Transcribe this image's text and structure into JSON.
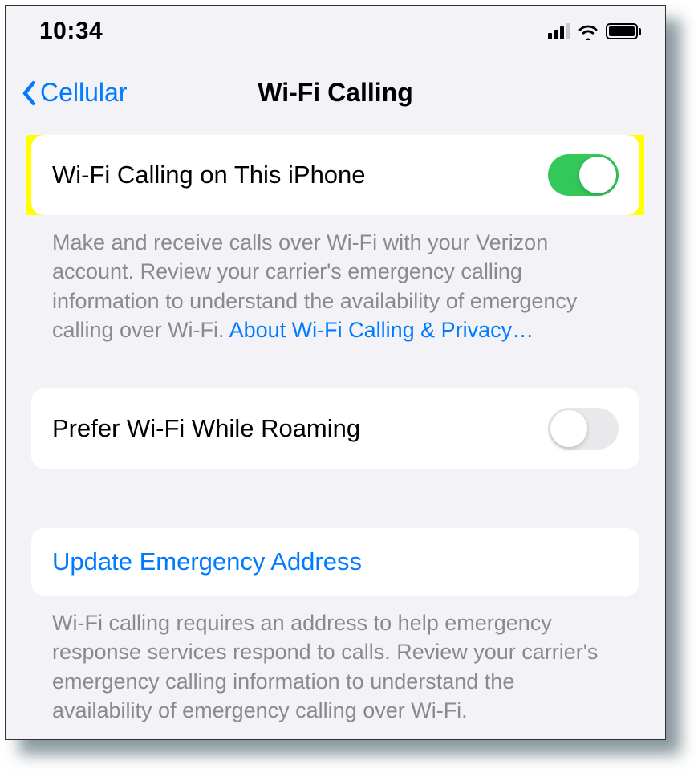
{
  "statusBar": {
    "time": "10:34"
  },
  "nav": {
    "back_label": "Cellular",
    "title": "Wi-Fi Calling"
  },
  "rows": {
    "wifi_calling": {
      "label": "Wi-Fi Calling on This iPhone",
      "enabled": true
    },
    "prefer_roaming": {
      "label": "Prefer Wi-Fi While Roaming",
      "enabled": false
    },
    "update_address": {
      "label": "Update Emergency Address"
    }
  },
  "footers": {
    "about_text": "Make and receive calls over Wi-Fi with your Verizon account. Review your carrier's emergency calling information to understand the availability of emergency calling over Wi-Fi. ",
    "about_link": "About Wi-Fi Calling & Privacy…",
    "emergency_text": "Wi-Fi calling requires an address to help emergency response services respond to calls. Review your carrier's emergency calling information to understand the availability of emergency calling over Wi-Fi."
  }
}
